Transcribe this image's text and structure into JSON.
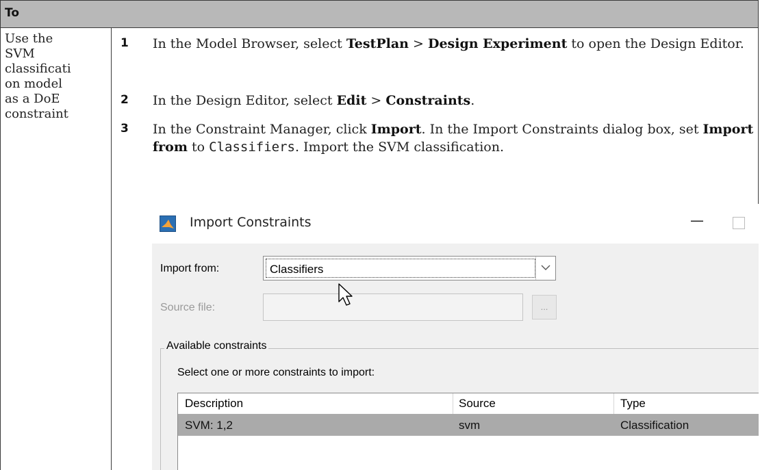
{
  "table": {
    "header": "To",
    "task": "Use the SVM classification model as a DoE constraint",
    "task_lines": [
      "Use the",
      "SVM",
      "classificati",
      "on model",
      "as a DoE",
      "constraint"
    ]
  },
  "steps": [
    {
      "number": "1",
      "parts": [
        "In the Model Browser, select ",
        "TestPlan",
        " > ",
        "Design Experiment",
        " to open the Design Editor."
      ]
    },
    {
      "number": "2",
      "parts": [
        "In the Design Editor, select ",
        "Edit",
        " > ",
        "Constraints",
        "."
      ]
    },
    {
      "number": "3",
      "parts": [
        "In the Constraint Manager, click ",
        "Import",
        ". In the Import Constraints dialog box, set ",
        "Import from",
        " to ",
        "Classifiers",
        ". Import the SVM classification."
      ]
    }
  ],
  "dialog": {
    "title": "Import Constraints",
    "minimize_glyph": "—",
    "import_from_label": "Import from:",
    "import_from_value": "Classifiers",
    "source_file_label": "Source file:",
    "browse_label": "...",
    "group_title": "Available constraints",
    "instructions": "Select one or more constraints to import:",
    "columns": [
      "Description",
      "Source",
      "Type"
    ],
    "rows": [
      {
        "description": "SVM: 1,2",
        "source": "svm",
        "type": "Classification"
      }
    ]
  },
  "colors": {
    "header_bg": "#b8b8b8",
    "selected_row": "#aaaaaa",
    "dialog_bg": "#f0f0f0"
  },
  "icons": [
    "matlab-icon",
    "chevron-down-icon",
    "mouse-pointer-icon"
  ]
}
